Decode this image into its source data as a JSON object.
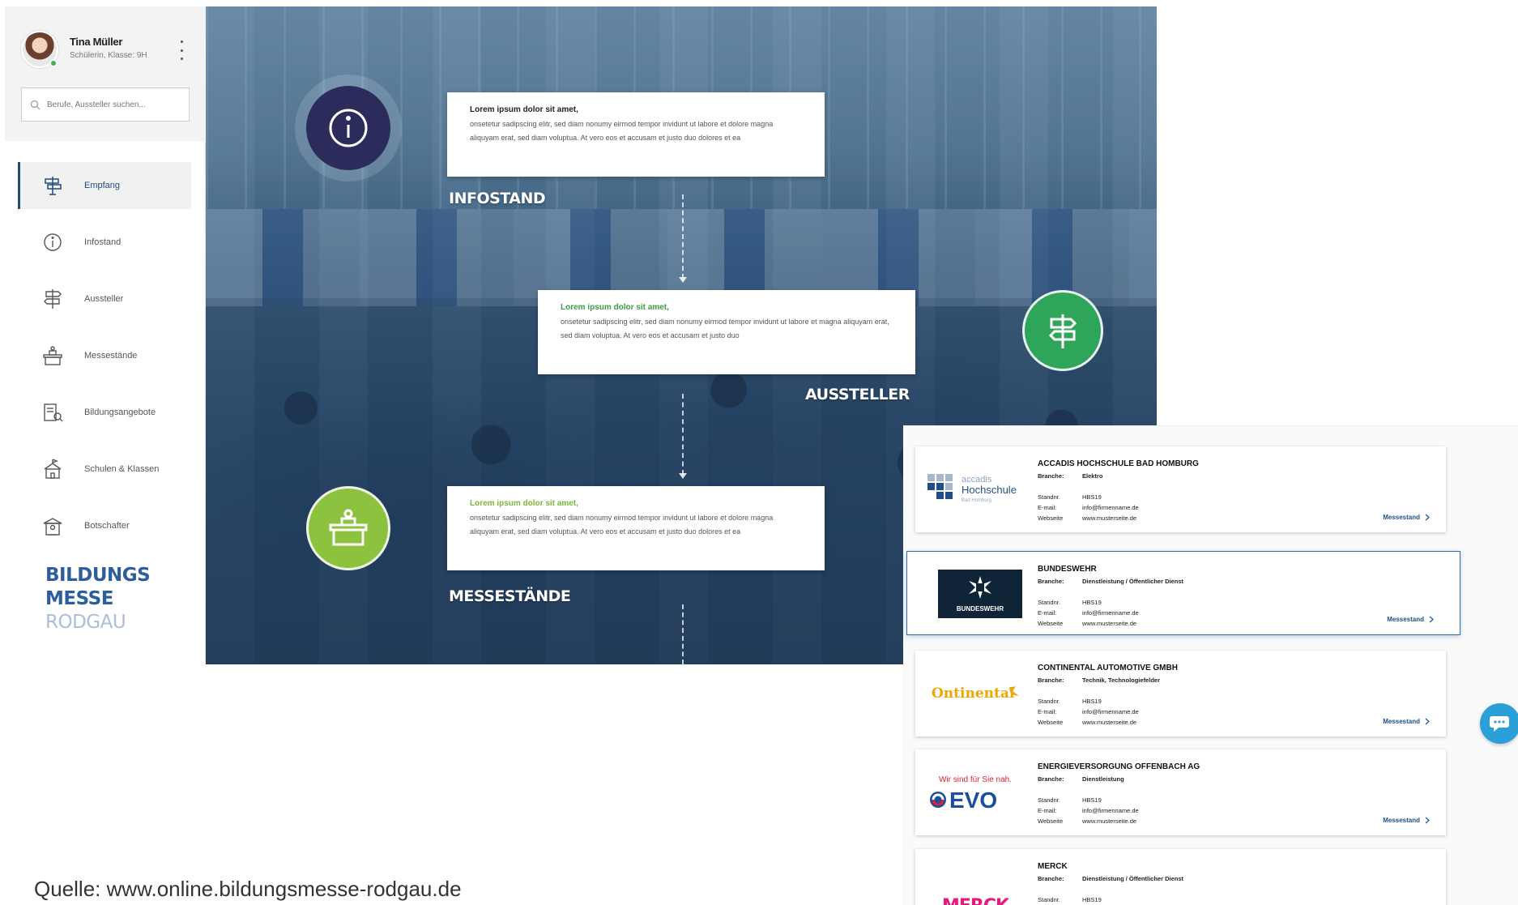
{
  "user": {
    "name": "Tina Müller",
    "role": "Schülerin, Klasse: 9H"
  },
  "search": {
    "placeholder": "Berufe, Aussteller suchen..."
  },
  "nav": {
    "items": [
      {
        "label": "Empfang",
        "icon": "reception-sign-icon",
        "active": true
      },
      {
        "label": "Infostand",
        "icon": "info-icon"
      },
      {
        "label": "Aussteller",
        "icon": "signpost-icon"
      },
      {
        "label": "Messestände",
        "icon": "booth-icon"
      },
      {
        "label": "Bildungsangebote",
        "icon": "education-offers-icon"
      },
      {
        "label": "Schulen & Klassen",
        "icon": "school-icon"
      },
      {
        "label": "Botschafter",
        "icon": "ambassador-icon"
      }
    ]
  },
  "brand": {
    "line1": "BILDUNGS",
    "line2": "MESSE",
    "line3": "RODGAU"
  },
  "hero": {
    "cards": [
      {
        "title": "Lorem ipsum dolor sit amet,",
        "body": "onsetetur sadipscing elitr, sed diam nonumy eirmod tempor invidunt ut labore et dolore magna aliquyam erat, sed diam voluptua. At vero eos et accusam et justo duo dolores et ea"
      },
      {
        "title": "Lorem ipsum dolor sit amet,",
        "body": "onsetetur sadipscing elitr, sed diam nonumy eirmod tempor invidunt ut labore et magna aliquyam erat, sed diam voluptua. At vero eos et accusam et justo duo"
      },
      {
        "title": "Lorem ipsum dolor sit amet,",
        "body": "onsetetur sadipscing elitr, sed diam nonumy eirmod tempor invidunt ut labore et dolore magna aliquyam erat, sed diam voluptua. At vero eos et accusam et justo duo dolores et ea"
      }
    ],
    "labels": [
      "INFOSTAND",
      "AUSSTELLER",
      "MESSESTÄNDE"
    ]
  },
  "exhibitors": {
    "keys": {
      "branche": "Branche:",
      "standnr": "Standnr.",
      "email": "E-mail:",
      "webseite": "Webseite"
    },
    "link_label": "Messestand",
    "items": [
      {
        "name": "ACCADIS HOCHSCHULE BAD HOMBURG",
        "branche": "Elektro",
        "standnr": "HBS19",
        "email": "info@firmenname.de",
        "webseite": "www.musterseite.de",
        "logo": {
          "line1": "accadis",
          "line2": "Hochschule",
          "line3": "Bad Homburg"
        }
      },
      {
        "name": "BUNDESWEHR",
        "branche": "Dienstleistung / Öffentlicher Dienst",
        "standnr": "HBS19",
        "email": "info@firmenname.de",
        "webseite": "www.musterseite.de",
        "logo": {
          "text": "BUNDESWEHR"
        }
      },
      {
        "name": "CONTINENTAL AUTOMOTIVE GMBH",
        "branche": "Technik, Technologiefelder",
        "standnr": "HBS19",
        "email": "info@firmenname.de",
        "webseite": "www.musterseite.de",
        "logo": {
          "text": "Ontinental"
        }
      },
      {
        "name": "ENERGIEVERSORGUNG OFFENBACH AG",
        "branche": "Dienstleistung",
        "standnr": "HBS19",
        "email": "info@firmenname.de",
        "webseite": "www.musterseite.de",
        "logo": {
          "tagline": "Wir sind für Sie nah.",
          "text": "EVO"
        }
      },
      {
        "name": "MERCK",
        "branche": "Dienstleistung / Öffentlicher Dienst",
        "standnr": "HBS19",
        "logo": {
          "text": "MERCK"
        }
      }
    ]
  },
  "source": "Quelle: www.online.bildungsmesse-rodgau.de",
  "colors": {
    "primary": "#1f4a7a",
    "info_circle": "#2c2c5c",
    "green": "#2fa55a",
    "lime": "#8cc23e",
    "chat": "#2a9fd8"
  }
}
